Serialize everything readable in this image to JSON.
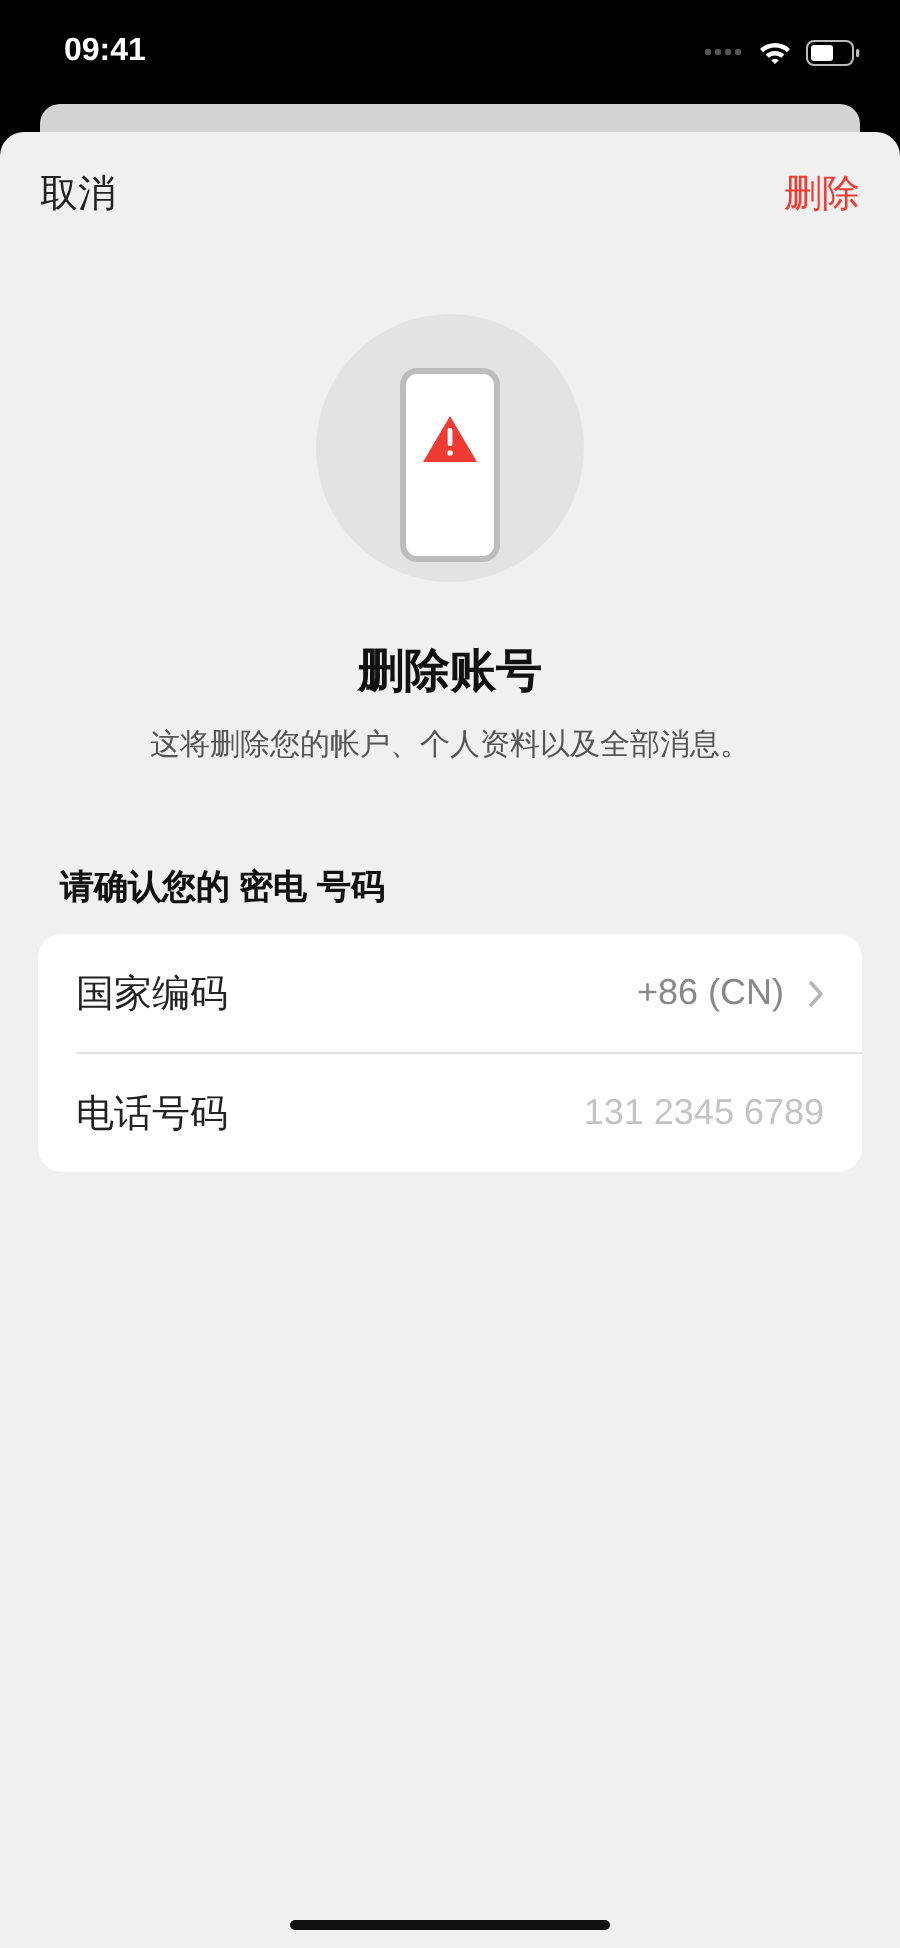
{
  "status_bar": {
    "time": "09:41"
  },
  "nav": {
    "cancel": "取消",
    "delete": "删除"
  },
  "title": "删除账号",
  "subtitle": "这将删除您的帐户、个人资料以及全部消息。",
  "section_heading": "请确认您的 密电 号码",
  "rows": [
    {
      "kind": "picker",
      "label": "国家编码",
      "value": "+86 (CN)"
    },
    {
      "kind": "input",
      "label": "电话号码",
      "placeholder": "131 2345 6789"
    }
  ]
}
